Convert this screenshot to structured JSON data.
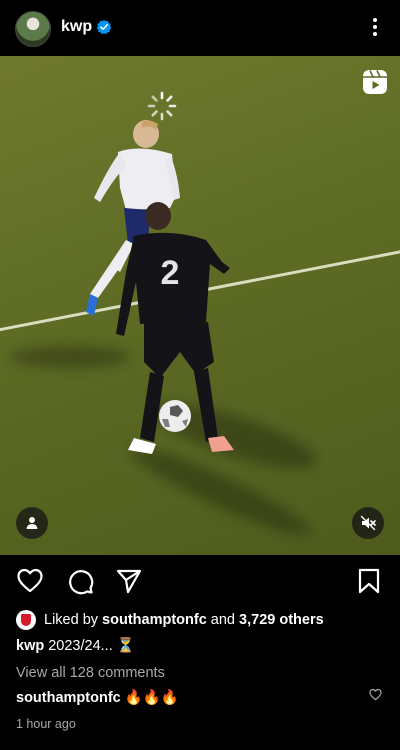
{
  "post": {
    "username": "kwp",
    "liked_by": {
      "prefix": "Liked by",
      "user": "southamptonfc",
      "middle": "and",
      "others": "3,729 others"
    },
    "caption": {
      "username": "kwp",
      "text": "2023/24...",
      "emoji": "⏳"
    },
    "comments_link": "View all 128 comments",
    "top_comment": {
      "username": "southamptonfc",
      "text": "🔥🔥🔥"
    },
    "timestamp": "1 hour ago"
  },
  "video": {
    "player_number": "2"
  },
  "colors": {
    "background": "#000000",
    "verified": "#0095f6",
    "secondary_text": "#a8a8a8",
    "pitch": "#5d6b24"
  },
  "icons": {
    "header": [
      "profile-avatar",
      "verified-badge-icon",
      "more-options-icon"
    ],
    "video": [
      "loading-spinner-icon",
      "reels-icon",
      "tagged-people-icon",
      "mute-icon"
    ],
    "actions": [
      "heart-icon",
      "comment-icon",
      "share-icon",
      "bookmark-icon"
    ]
  }
}
